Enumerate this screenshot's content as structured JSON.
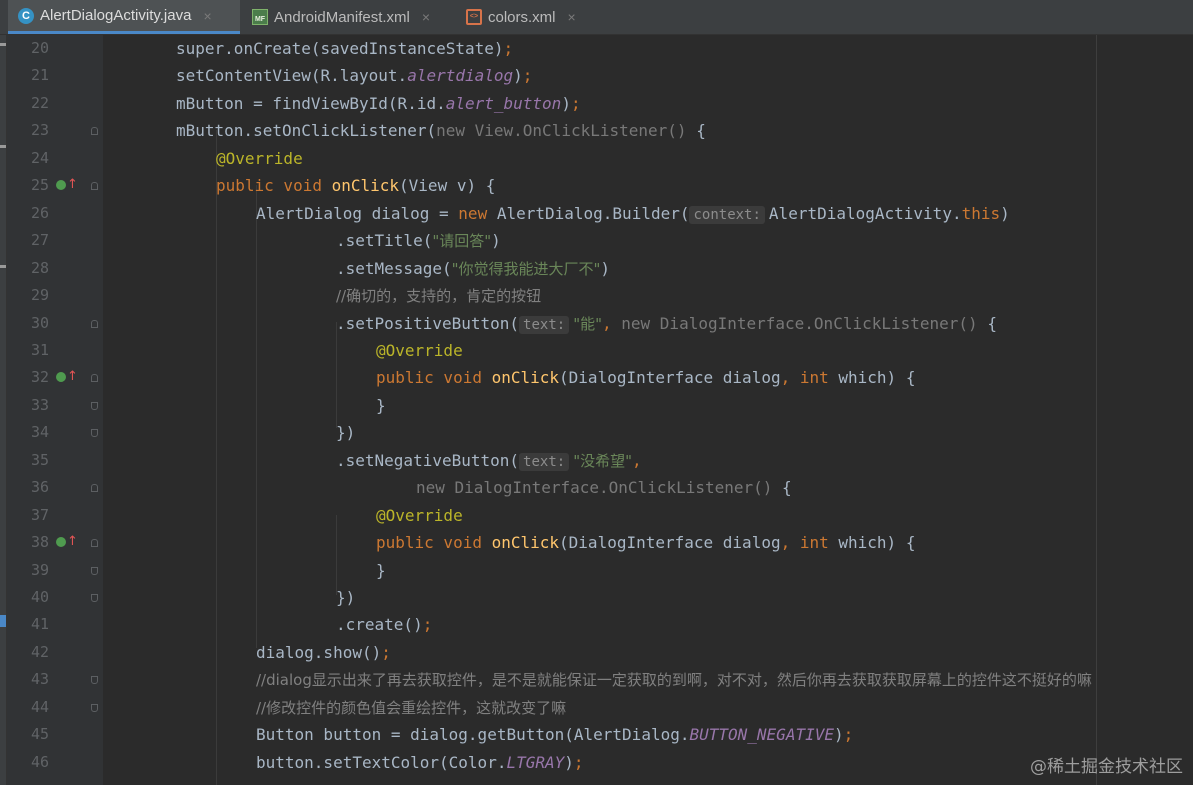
{
  "tabs": [
    {
      "label": "AlertDialogActivity.java",
      "icon": "java-class-icon",
      "active": true,
      "close": "×"
    },
    {
      "label": "AndroidManifest.xml",
      "icon": "manifest-icon",
      "active": false,
      "close": "×"
    },
    {
      "label": "colors.xml",
      "icon": "xml-icon",
      "active": false,
      "close": "×"
    }
  ],
  "tab_icon_glyphs": {
    "java": "C",
    "manifest": "MF",
    "xml": "<>"
  },
  "gutter": {
    "line_numbers": [
      "20",
      "21",
      "22",
      "23",
      "24",
      "25",
      "26",
      "27",
      "28",
      "29",
      "30",
      "31",
      "32",
      "33",
      "34",
      "35",
      "36",
      "37",
      "38",
      "39",
      "40",
      "41",
      "42",
      "43",
      "44",
      "45",
      "46"
    ],
    "override_markers": {
      "arrow": "↑"
    }
  },
  "code": {
    "lines": [
      [
        [
          "nm",
          "super"
        ],
        [
          "nm",
          ".onCreate(savedInstanceState)"
        ],
        [
          "kw",
          ";"
        ]
      ],
      [
        [
          "nm",
          "setContentView(R.layout."
        ],
        [
          "fd",
          "alertdialog"
        ],
        [
          "nm",
          ")"
        ],
        [
          "kw",
          ";"
        ]
      ],
      [
        [
          "nm",
          "mButton = findViewById(R.id."
        ],
        [
          "fd",
          "alert_button"
        ],
        [
          "nm",
          ")"
        ],
        [
          "kw",
          ";"
        ]
      ],
      [
        [
          "nm",
          "mButton.setOnClickListener("
        ],
        [
          "gy",
          "new View.OnClickListener() "
        ],
        [
          "nm",
          "{"
        ]
      ],
      [
        [
          "an",
          "@Override"
        ]
      ],
      [
        [
          "kw",
          "public void "
        ],
        [
          "fn",
          "onClick"
        ],
        [
          "nm",
          "(View v) {"
        ]
      ],
      [
        [
          "nm",
          "AlertDialog dialog = "
        ],
        [
          "kw",
          "new "
        ],
        [
          "nm",
          "AlertDialog.Builder("
        ],
        [
          "hint",
          "context:"
        ],
        [
          "nm",
          "AlertDialogActivity."
        ],
        [
          "kw",
          "this"
        ],
        [
          "nm",
          ")"
        ]
      ],
      [
        [
          "nm",
          ".setTitle("
        ],
        [
          "st",
          "\"请回答\""
        ],
        [
          "nm",
          ")"
        ]
      ],
      [
        [
          "nm",
          ".setMessage("
        ],
        [
          "st",
          "\"你觉得我能进大厂不\""
        ],
        [
          "nm",
          ")"
        ]
      ],
      [
        [
          "cm",
          "//确切的，支持的，肯定的按钮"
        ]
      ],
      [
        [
          "nm",
          ".setPositiveButton("
        ],
        [
          "hint",
          "text:"
        ],
        [
          "st",
          "\"能\""
        ],
        [
          "kw",
          ", "
        ],
        [
          "gy",
          "new DialogInterface.OnClickListener() "
        ],
        [
          "nm",
          "{"
        ]
      ],
      [
        [
          "an",
          "@Override"
        ]
      ],
      [
        [
          "kw",
          "public void "
        ],
        [
          "fn",
          "onClick"
        ],
        [
          "nm",
          "(DialogInterface dialog"
        ],
        [
          "kw",
          ", int "
        ],
        [
          "nm",
          "which) {"
        ]
      ],
      [
        [
          "nm",
          "}"
        ]
      ],
      [
        [
          "nm",
          "})"
        ]
      ],
      [
        [
          "nm",
          ".setNegativeButton("
        ],
        [
          "hint",
          "text:"
        ],
        [
          "st",
          "\"没希望\""
        ],
        [
          "kw",
          ","
        ]
      ],
      [
        [
          "gy",
          "new DialogInterface.OnClickListener() "
        ],
        [
          "nm",
          "{"
        ]
      ],
      [
        [
          "an",
          "@Override"
        ]
      ],
      [
        [
          "kw",
          "public void "
        ],
        [
          "fn",
          "onClick"
        ],
        [
          "nm",
          "(DialogInterface dialog"
        ],
        [
          "kw",
          ", int "
        ],
        [
          "nm",
          "which) {"
        ]
      ],
      [
        [
          "nm",
          "}"
        ]
      ],
      [
        [
          "nm",
          "})"
        ]
      ],
      [
        [
          "nm",
          ".create()"
        ],
        [
          "kw",
          ";"
        ]
      ],
      [
        [
          "nm",
          "dialog.show()"
        ],
        [
          "kw",
          ";"
        ]
      ],
      [
        [
          "cm",
          "//dialog显示出来了再去获取控件，是不是就能保证一定获取的到啊，对不对，然后你再去获取获取屏幕上的控件这不挺好的嘛"
        ]
      ],
      [
        [
          "cm",
          "//修改控件的颜色值会重绘控件，这就改变了嘛"
        ]
      ],
      [
        [
          "nm",
          "Button button = dialog.getButton(AlertDialog."
        ],
        [
          "fd",
          "BUTTON_NEGATIVE"
        ],
        [
          "nm",
          ")"
        ],
        [
          "kw",
          ";"
        ]
      ],
      [
        [
          "nm",
          "button.setTextColor(Color."
        ],
        [
          "fd",
          "LTGRAY"
        ],
        [
          "nm",
          ")"
        ],
        [
          "kw",
          ";"
        ]
      ]
    ]
  },
  "watermark": "@稀土掘金技术社区",
  "colors": {
    "editor_bg": "#2b2b2b",
    "gutter_bg": "#313335",
    "tabbar_bg": "#3c3f41",
    "accent": "#4a88c7"
  }
}
